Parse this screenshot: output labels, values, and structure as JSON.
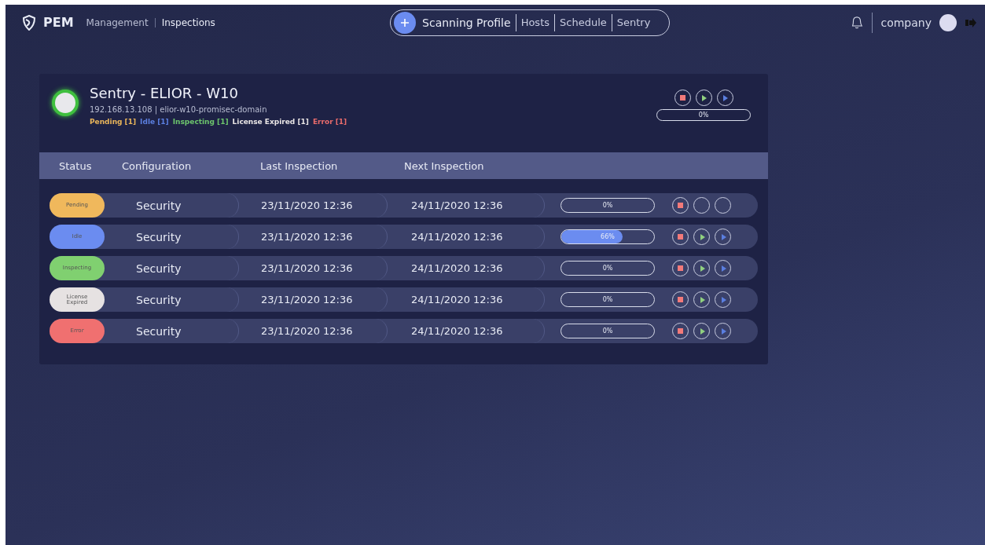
{
  "brand": {
    "name": "PEM"
  },
  "breadcrumb": [
    "Management",
    "Inspections"
  ],
  "nav_tabs": [
    "Scanning Profile",
    "Hosts",
    "Schedule",
    "Sentry"
  ],
  "user": {
    "name": "company"
  },
  "host": {
    "title": "Sentry - ELIOR - W10",
    "subtitle": "192.168.13.108 | elior-w10-promisec-domain",
    "reading": "0%",
    "counts": [
      {
        "label": "Pending [1]",
        "color": "#e8b45a"
      },
      {
        "label": "Idle [1]",
        "color": "#5b7fe0"
      },
      {
        "label": "Inspecting [1]",
        "color": "#6cc46c"
      },
      {
        "label": "License Expired [1]",
        "color": "#e8e4e4"
      },
      {
        "label": "Error [1]",
        "color": "#e86b6b"
      }
    ]
  },
  "table": {
    "columns": [
      "Status",
      "Configuration",
      "Last Inspection",
      "Next Inspection"
    ],
    "rows": [
      {
        "status": "Pending",
        "color": "#f0b85c",
        "configuration": "Security",
        "last": "23/11/2020 12:36",
        "next": "24/11/2020 12:36",
        "reading": "0%",
        "controls_enabled": false
      },
      {
        "status": "Idle",
        "color": "#6b8cf0",
        "configuration": "Security",
        "last": "23/11/2020 12:36",
        "next": "24/11/2020 12:36",
        "level": 0.66,
        "reading": "66%",
        "controls_enabled": true
      },
      {
        "status": "Inspecting",
        "color": "#80d070",
        "configuration": "Security",
        "last": "23/11/2020 12:36",
        "next": "24/11/2020 12:36",
        "reading": "0%",
        "controls_enabled": true
      },
      {
        "status": "License Expired",
        "color": "#e6e2e2",
        "configuration": "Security",
        "last": "23/11/2020 12:36",
        "next": "24/11/2020 12:36",
        "reading": "0%",
        "controls_enabled": true
      },
      {
        "status": "Error",
        "color": "#f07070",
        "configuration": "Security",
        "last": "23/11/2020 12:36",
        "next": "24/11/2020 12:36",
        "reading": "0%",
        "controls_enabled": true
      }
    ]
  }
}
